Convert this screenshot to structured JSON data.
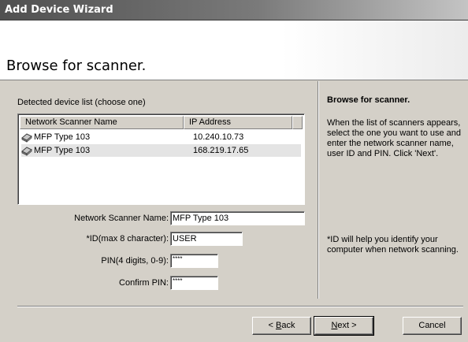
{
  "window": {
    "title": "Add Device Wizard"
  },
  "header": {
    "heading": "Browse for scanner."
  },
  "device_list": {
    "label": "Detected device list (choose one)",
    "columns": [
      "Network Scanner Name",
      "IP Address"
    ],
    "rows": [
      {
        "icon": "scanner-icon",
        "name": "MFP Type 103",
        "ip": "10.240.10.73"
      },
      {
        "icon": "scanner-icon",
        "name": "MFP Type 103",
        "ip": "168.219.17.65"
      }
    ]
  },
  "form": {
    "scanner_name_label": "Network Scanner Name:",
    "scanner_name_value": "MFP Type 103",
    "id_label": "*ID(max 8 character):",
    "id_value": "USER",
    "pin_label": "PIN(4 digits, 0-9):",
    "pin_value": "****",
    "confirm_pin_label": "Confirm PIN:",
    "confirm_pin_value": "****"
  },
  "help": {
    "title": "Browse for scanner.",
    "text": "When the list of scanners appears, select the one you want to use and enter the network scanner name, user ID and PIN. Click 'Next'.",
    "note": "*ID will help you identify your computer when network scanning."
  },
  "buttons": {
    "back_prefix": "< ",
    "back_accel": "B",
    "back_rest": "ack",
    "next_accel": "N",
    "next_rest": "ext >",
    "cancel": "Cancel"
  }
}
